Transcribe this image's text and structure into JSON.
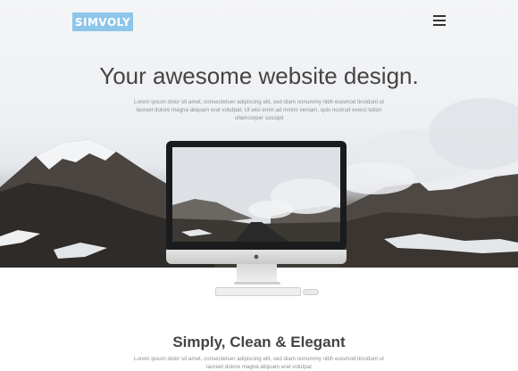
{
  "brand": {
    "logo_text": "SIMVOLY"
  },
  "hero": {
    "headline": "Your awesome website design.",
    "lead": "Lorem ipsum dolor sit amet, consectetuer adipiscing elit, sed diam nonummy nibh euismod tincidunt ut laoreet dolore magna aliquam erat volutpat. Ut wisi enim ad minim veniam, quis nostrud exerci tation ullamcorper suscipit"
  },
  "device": {
    "logo_glyph": ""
  },
  "section": {
    "title": "Simply, Clean & Elegant",
    "text": "Lorem ipsum dolor sit amet, consectetuer adipiscing elit, sed diam nonummy nibh euismod tincidunt ut laoreet dolore magna aliquam erat volutpat"
  },
  "icons": {
    "menu": "hamburger-menu-icon"
  },
  "colors": {
    "logo_bg": "#8dc6ea",
    "heading": "#444444",
    "body_text": "#8b8f95"
  }
}
